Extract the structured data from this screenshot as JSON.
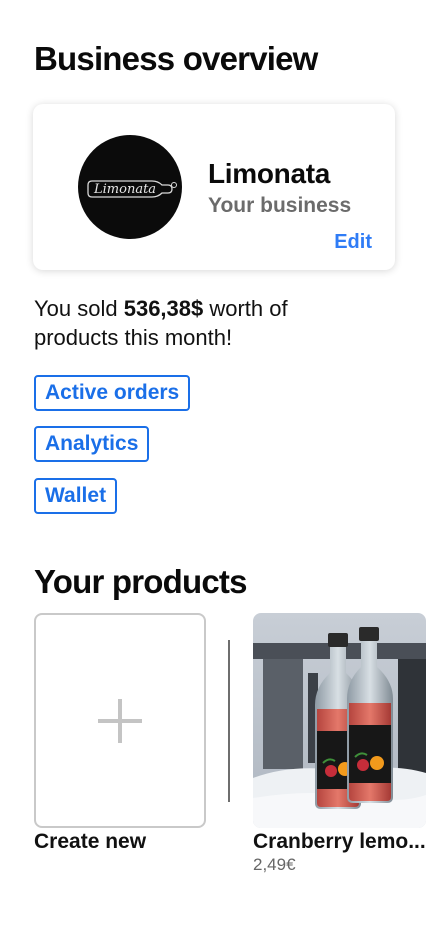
{
  "overview": {
    "title": "Business overview",
    "business": {
      "logo_icon": "limonata-logo",
      "logo_text": "Limonata",
      "name": "Limonata",
      "subtitle": "Your business",
      "edit_label": "Edit"
    },
    "sales": {
      "prefix": "You sold ",
      "amount": "536,38$",
      "suffix": " worth of products this month!"
    },
    "links": [
      {
        "label": "Active orders"
      },
      {
        "label": "Analytics"
      },
      {
        "label": "Wallet"
      }
    ]
  },
  "products": {
    "title": "Your products",
    "create_label": "Create new",
    "create_icon": "plus-icon",
    "items": [
      {
        "name": "Cranberry lemo...",
        "price": "2,49€",
        "image": "two bottles of cranberry lemonade in snow"
      }
    ]
  },
  "colors": {
    "accent": "#1a6fe8",
    "edit": "#2f7cf6",
    "muted": "#6b6b6b"
  }
}
